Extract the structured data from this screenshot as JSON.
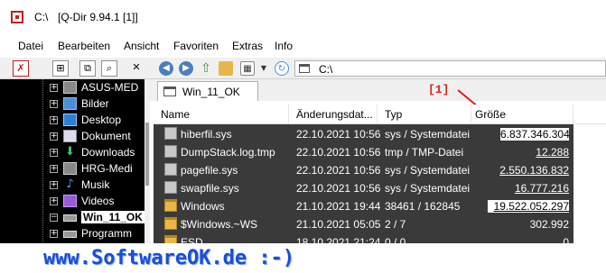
{
  "window": {
    "path": "C:\\",
    "app_title": "[Q-Dir 9.94.1 [1]]"
  },
  "menu": [
    "Datei",
    "Bearbeiten",
    "Ansicht",
    "Favoriten",
    "Extras",
    "Info"
  ],
  "left_toolbar": {
    "icons": [
      "red-x-icon",
      "grid-icon",
      "copy-icon",
      "search-icon",
      "close-icon"
    ]
  },
  "tree": {
    "items": [
      {
        "label": "ASUS-MED",
        "icon": "drive-icon"
      },
      {
        "label": "Bilder",
        "icon": "pictures-icon"
      },
      {
        "label": "Desktop",
        "icon": "desktop-icon"
      },
      {
        "label": "Dokument",
        "icon": "documents-icon"
      },
      {
        "label": "Downloads",
        "icon": "downloads-icon"
      },
      {
        "label": "HRG-Medi",
        "icon": "drive-icon"
      },
      {
        "label": "Musik",
        "icon": "music-icon"
      },
      {
        "label": "Videos",
        "icon": "videos-icon"
      },
      {
        "label": "Win_11_OK",
        "icon": "drive-icon",
        "selected": true
      },
      {
        "label": "Programm",
        "icon": "drive-icon"
      }
    ]
  },
  "address": {
    "value": "C:\\"
  },
  "tab": {
    "label": "Win_11_OK"
  },
  "annotation": {
    "label": "[1]",
    "color": "#e0201e"
  },
  "columns": {
    "name": "Name",
    "date": "Änderungsdat...",
    "type": "Typ",
    "size": "Größe"
  },
  "files": [
    {
      "name": "hiberfil.sys",
      "date": "22.10.2021 10:56",
      "type": "sys / Systemdatei",
      "size": "6.837.346.304",
      "kind": "file",
      "style": "box"
    },
    {
      "name": "DumpStack.log.tmp",
      "date": "22.10.2021 10:56",
      "type": "tmp / TMP-Datei",
      "size": "12.288",
      "kind": "file",
      "style": "underline"
    },
    {
      "name": "pagefile.sys",
      "date": "22.10.2021 10:56",
      "type": "sys / Systemdatei",
      "size": "2.550.136.832",
      "kind": "file",
      "style": "underline"
    },
    {
      "name": "swapfile.sys",
      "date": "22.10.2021 10:56",
      "type": "sys / Systemdatei",
      "size": "16.777.216",
      "kind": "file",
      "style": "underline"
    },
    {
      "name": "Windows",
      "date": "21.10.2021 19:44",
      "type": "38461 / 162845",
      "size": "19.522.052.297",
      "kind": "folder",
      "style": "box"
    },
    {
      "name": "$Windows.~WS",
      "date": "21.10.2021 05:05",
      "type": "2 / 7",
      "size": "302.992",
      "kind": "folder",
      "style": "plain"
    },
    {
      "name": "ESD",
      "date": "18.10.2021 21:24",
      "type": "0 / 0",
      "size": "0",
      "kind": "folder",
      "style": "plain"
    }
  ],
  "watermark": {
    "text": "www.SoftwareOK.de :-)"
  }
}
